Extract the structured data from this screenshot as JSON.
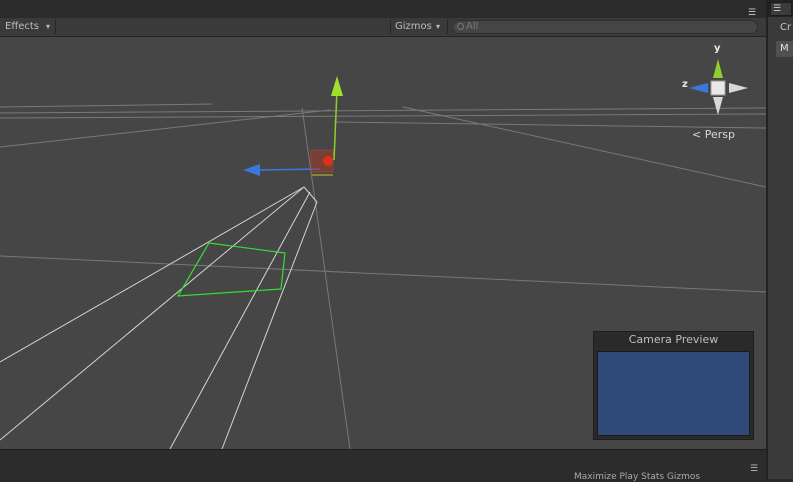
{
  "toolbar": {
    "effects_label": "Effects",
    "effects_caret": "▾",
    "gizmos_label": "Gizmos",
    "gizmos_caret": "▾",
    "search_placeholder": "All",
    "search_icon": "search-icon"
  },
  "scene": {
    "orientation_label": "Persp",
    "axis_y_label": "y",
    "axis_z_label": "z"
  },
  "camera_preview": {
    "title": "Camera Preview",
    "screen_color": "#2f4a78"
  },
  "right_panel": {
    "tab_icon": "list-icon",
    "tab_glyph": "☰",
    "row1_label": "Cr",
    "row2_label": "M"
  },
  "bottom_panel": {
    "menu_glyph": "☰",
    "tabs_text": "Maximize  Play  Stats  Gizmos"
  },
  "colors": {
    "viewport_bg": "#464646",
    "toolbar_bg": "#3a3a3a",
    "axis_x": "#d03020",
    "axis_y": "#8ed02a",
    "axis_z": "#3a78e0",
    "selection": "#32e032"
  }
}
